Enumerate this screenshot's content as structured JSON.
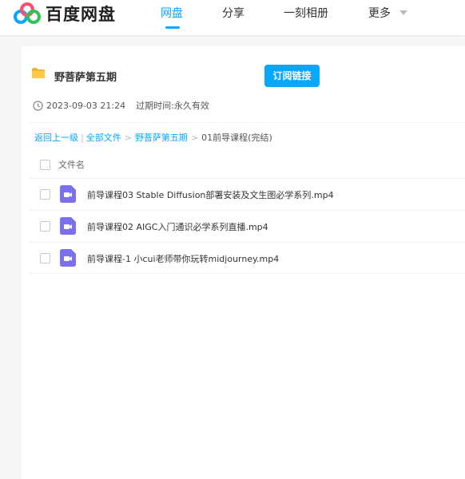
{
  "header": {
    "logo_text": "百度网盘",
    "nav": [
      {
        "label": "网盘",
        "active": true
      },
      {
        "label": "分享",
        "active": false
      },
      {
        "label": "一刻相册",
        "active": false
      },
      {
        "label": "更多",
        "active": false
      }
    ],
    "accent_color": "#06a7ff"
  },
  "share": {
    "title": "野菩萨第五期",
    "subscribe_label": "订阅链接",
    "date": "2023-09-03 21:24",
    "expire_label": "过期时间:永久有效"
  },
  "breadcrumb": {
    "back": "返回上一级",
    "all_files": "全部文件",
    "folder": "野菩萨第五期",
    "current": "01前导课程(完结)"
  },
  "table": {
    "column_filename": "文件名",
    "files": [
      {
        "name": "前导课程03 Stable Diffusion部署安装及文生图必学系列.mp4",
        "icon": "video-file-icon"
      },
      {
        "name": "前导课程02 AIGC入门通识必学系列直播.mp4",
        "icon": "video-file-icon"
      },
      {
        "name": "前导课程-1 小cui老师带你玩转midjourney.mp4",
        "icon": "video-file-icon"
      }
    ]
  }
}
